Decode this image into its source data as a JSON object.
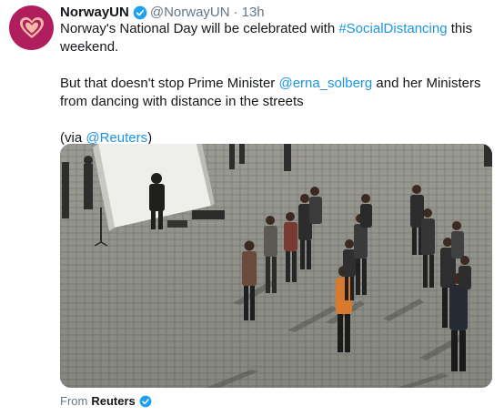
{
  "tweet": {
    "author_name": "NorwayUN",
    "author_handle": "@NorwayUN",
    "separator": "·",
    "time": "13h",
    "line1_pre": "Norway's National Day will be celebrated with ",
    "hashtag": "#SocialDistancing",
    "line1_post": " this weekend.",
    "line2_pre": "But that doesn't stop Prime Minister ",
    "mention": "@erna_solberg",
    "line2_post": " and her Ministers from dancing with distance in the streets",
    "line3_pre": "(via ",
    "via_mention": "@Reuters",
    "line3_post": ")"
  },
  "media": {
    "from_label": "From",
    "source": "Reuters"
  },
  "colors": {
    "link": "#1b95e0",
    "verified": "#1da1f2",
    "avatar_bg": "#b01e5d",
    "heart": "#f3b9a6"
  },
  "icons": {
    "avatar": "heart-logo",
    "verified": "verified-badge-icon"
  }
}
